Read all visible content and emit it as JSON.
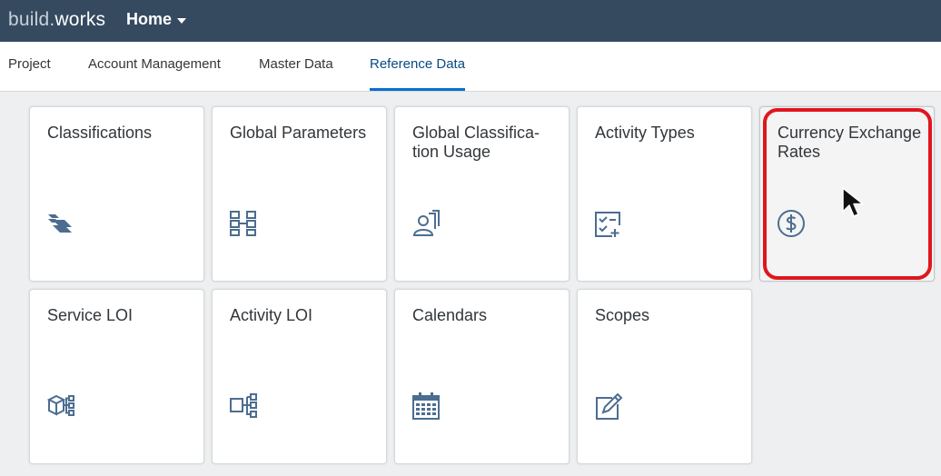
{
  "app": {
    "logo_part1": "build",
    "logo_dot": ".",
    "logo_part2": "works",
    "home_label": "Home"
  },
  "tabs": [
    {
      "label": "Project"
    },
    {
      "label": "Account Management"
    },
    {
      "label": "Master Data"
    },
    {
      "label": "Reference Data",
      "selected": true
    }
  ],
  "tiles": [
    {
      "title": "Classifications",
      "icon": "classifications-icon"
    },
    {
      "title": "Global Parameters",
      "icon": "global-parameters-icon"
    },
    {
      "title": "Global Classifica-tion Usage",
      "icon": "classification-usage-icon"
    },
    {
      "title": "Activity Types",
      "icon": "activity-types-icon"
    },
    {
      "title": "Currency Exchange Rates",
      "icon": "dollar-icon"
    },
    {
      "title": "Service LOI",
      "icon": "service-loi-icon"
    },
    {
      "title": "Activity LOI",
      "icon": "activity-loi-icon"
    },
    {
      "title": "Calendars",
      "icon": "calendar-icon"
    },
    {
      "title": "Scopes",
      "icon": "scopes-icon"
    }
  ],
  "colors": {
    "shellbar": "#354a5f",
    "accent": "#0a6ed1",
    "icon": "#4c6d90",
    "highlight": "#e0161f"
  }
}
